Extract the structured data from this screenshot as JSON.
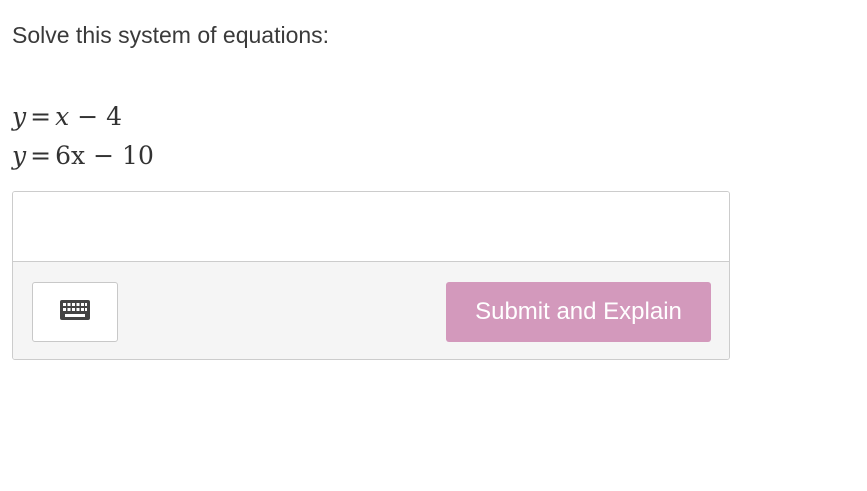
{
  "question": {
    "prompt": "Solve this system of equations:",
    "equations": [
      {
        "lhs": "y",
        "rel": "=",
        "terms": [
          "x",
          "−",
          "4"
        ]
      },
      {
        "lhs": "y",
        "rel": "=",
        "terms": [
          "6x",
          "−",
          "10"
        ]
      }
    ]
  },
  "answer": {
    "value": "",
    "placeholder": ""
  },
  "toolbar": {
    "keyboard_icon": "keyboard-icon",
    "submit_label": "Submit and Explain",
    "submit_color": "#d399bc"
  }
}
